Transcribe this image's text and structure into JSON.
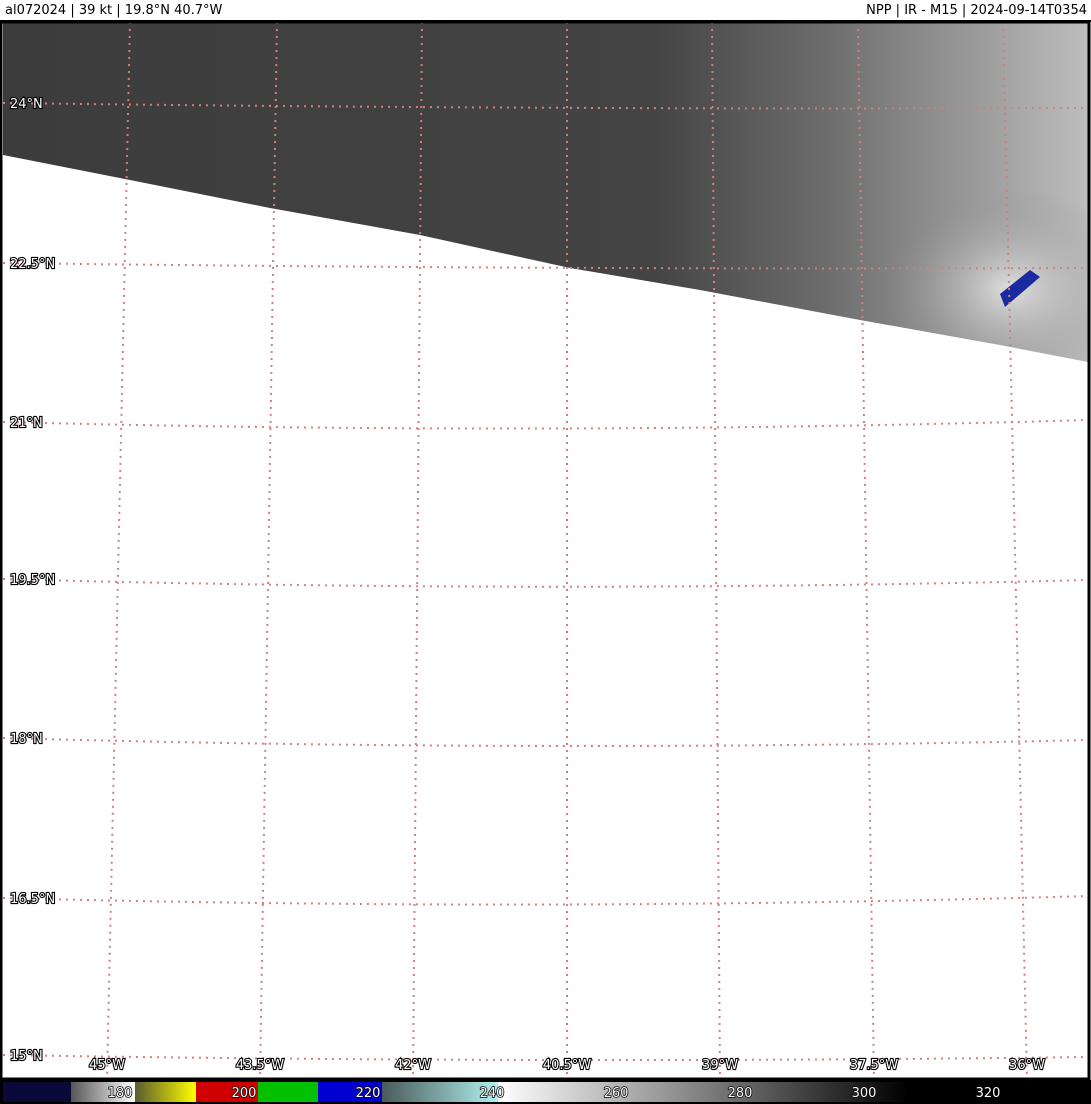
{
  "header": {
    "left": "al072024     |  39 kt | 19.8°N 40.7°W",
    "right": "NPP | IR - M15 | 2024-09-14T0354"
  },
  "map": {
    "lat_labels": [
      "24°N",
      "22.5°N",
      "21°N",
      "19.5°N",
      "18°N",
      "16.5°N",
      "15°N"
    ],
    "lon_labels": [
      "45°W",
      "43.5°W",
      "42°W",
      "40.5°W",
      "39°W",
      "37.5°W",
      "36°W"
    ],
    "grid_color": "#d08080"
  },
  "colorbar": {
    "ticks": [
      "180",
      "200",
      "220",
      "240",
      "260",
      "280",
      "300",
      "320"
    ],
    "unit_values": [
      180,
      200,
      220,
      240,
      260,
      280,
      300,
      320
    ]
  }
}
